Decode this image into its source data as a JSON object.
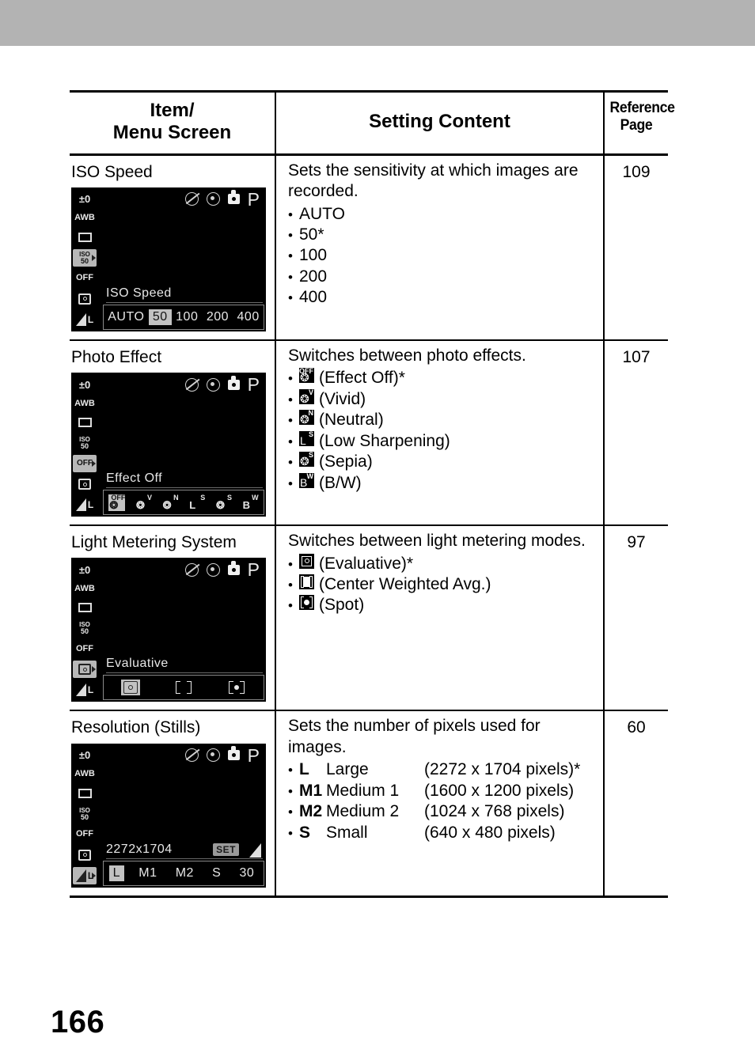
{
  "page": {
    "number": "166"
  },
  "table": {
    "headers": {
      "item": "Item/",
      "item_line2": "Menu Screen",
      "setting": "Setting Content",
      "reference": "Reference",
      "reference_line2": "Page"
    },
    "rows": [
      {
        "item": "ISO Speed",
        "ref_page": "109",
        "description": "Sets the sensitivity at which images are recorded.",
        "options": [
          {
            "text": "AUTO"
          },
          {
            "text": "50*"
          },
          {
            "text": "100"
          },
          {
            "text": "200"
          },
          {
            "text": "400"
          }
        ],
        "lcd": {
          "label": "ISO Speed",
          "bar_items": [
            {
              "text": "AUTO",
              "selected": false
            },
            {
              "text": "50",
              "selected": true
            },
            {
              "text": "100",
              "selected": false
            },
            {
              "text": "200",
              "selected": false
            },
            {
              "text": "400",
              "selected": false
            }
          ],
          "side_icons": [
            {
              "name": "exposure-compensation",
              "text": "±0",
              "selected": false
            },
            {
              "name": "white-balance",
              "text": "AWB",
              "selected": false
            },
            {
              "name": "drive-mode",
              "text": "",
              "selected": false
            },
            {
              "name": "iso-speed",
              "text": "ISO",
              "sub": "50",
              "selected": true
            },
            {
              "name": "flash-off",
              "text": "OFF",
              "selected": false
            },
            {
              "name": "metering",
              "text": "",
              "selected": false
            },
            {
              "name": "image-quality",
              "text": "L",
              "selected": false
            }
          ],
          "top_icons": [
            "flash-off-icon",
            "red-eye-icon",
            "macro-icon",
            "mode-p"
          ],
          "mode": "P"
        }
      },
      {
        "item": "Photo Effect",
        "ref_page": "107",
        "description": "Switches between photo effects.",
        "options": [
          {
            "glyph_sub": "OFF",
            "glyph_main": "❂",
            "text": "(Effect Off)*"
          },
          {
            "glyph_sub": "V",
            "glyph_main": "❂",
            "text": "(Vivid)"
          },
          {
            "glyph_sub": "N",
            "glyph_main": "❂",
            "text": "(Neutral)"
          },
          {
            "glyph_sub": "S",
            "glyph_main": "L",
            "text": "(Low Sharpening)"
          },
          {
            "glyph_sub": "S",
            "glyph_main": "❂",
            "text": "(Sepia)"
          },
          {
            "glyph_sub": "W",
            "glyph_main": "B",
            "text": "(B/W)"
          }
        ],
        "lcd": {
          "label": "Effect Off",
          "bar_items": [
            {
              "sub": "OFF",
              "main": "❂",
              "selected": true
            },
            {
              "sub": "V",
              "main": "❂",
              "selected": false
            },
            {
              "sub": "N",
              "main": "❂",
              "selected": false
            },
            {
              "sub": "S",
              "main": "L",
              "selected": false
            },
            {
              "sub": "S",
              "main": "❂",
              "selected": false
            },
            {
              "sub": "W",
              "main": "B",
              "selected": false
            }
          ],
          "side_icons": [
            {
              "name": "exposure-compensation",
              "text": "±0",
              "selected": false
            },
            {
              "name": "white-balance",
              "text": "AWB",
              "selected": false
            },
            {
              "name": "drive-mode",
              "text": "",
              "selected": false
            },
            {
              "name": "iso-speed",
              "text": "ISO",
              "sub": "50",
              "selected": false
            },
            {
              "name": "photo-effect",
              "text": "OFF",
              "selected": true
            },
            {
              "name": "metering",
              "text": "",
              "selected": false
            },
            {
              "name": "image-quality",
              "text": "L",
              "selected": false
            }
          ],
          "mode": "P"
        }
      },
      {
        "item": "Light Metering System",
        "ref_page": "97",
        "description": "Switches between light metering modes.",
        "options": [
          {
            "metering": "evaluative",
            "text": "(Evaluative)*"
          },
          {
            "metering": "center-weighted",
            "text": "(Center Weighted Avg.)"
          },
          {
            "metering": "spot",
            "text": "(Spot)"
          }
        ],
        "lcd": {
          "label": "Evaluative",
          "bar_metering": [
            {
              "type": "evaluative",
              "selected": true
            },
            {
              "type": "center-weighted",
              "selected": false
            },
            {
              "type": "spot",
              "selected": false
            }
          ],
          "side_icons": [
            {
              "name": "exposure-compensation",
              "text": "±0",
              "selected": false
            },
            {
              "name": "white-balance",
              "text": "AWB",
              "selected": false
            },
            {
              "name": "drive-mode",
              "text": "",
              "selected": false
            },
            {
              "name": "iso-speed",
              "text": "ISO",
              "sub": "50",
              "selected": false
            },
            {
              "name": "flash-off",
              "text": "OFF",
              "selected": false
            },
            {
              "name": "metering",
              "text": "",
              "selected": true
            },
            {
              "name": "image-quality",
              "text": "L",
              "selected": false
            }
          ],
          "mode": "P"
        }
      },
      {
        "item": "Resolution (Stills)",
        "ref_page": "60",
        "description": "Sets the number of pixels used for images.",
        "options": [
          {
            "code": "L",
            "name": "Large",
            "pixels": "(2272 x 1704 pixels)*"
          },
          {
            "code": "M1",
            "name": "Medium 1",
            "pixels": "(1600 x 1200 pixels)"
          },
          {
            "code": "M2",
            "name": "Medium 2",
            "pixels": "(1024 x 768 pixels)"
          },
          {
            "code": "S",
            "name": "Small",
            "pixels": "(640 x 480 pixels)"
          }
        ],
        "lcd": {
          "label": "2272x1704",
          "set_badge": "SET",
          "bar_items": [
            {
              "text": "L",
              "selected": true
            },
            {
              "text": "M1",
              "selected": false
            },
            {
              "text": "M2",
              "selected": false
            },
            {
              "text": "S",
              "selected": false
            },
            {
              "text": "30",
              "selected": false
            }
          ],
          "side_icons": [
            {
              "name": "exposure-compensation",
              "text": "±0",
              "selected": false
            },
            {
              "name": "white-balance",
              "text": "AWB",
              "selected": false
            },
            {
              "name": "drive-mode",
              "text": "",
              "selected": false
            },
            {
              "name": "iso-speed",
              "text": "ISO",
              "sub": "50",
              "selected": false
            },
            {
              "name": "flash-off",
              "text": "OFF",
              "selected": false
            },
            {
              "name": "metering",
              "text": "",
              "selected": false
            },
            {
              "name": "image-quality",
              "text": "L",
              "selected": true
            }
          ],
          "mode": "P"
        }
      }
    ]
  },
  "colors": {
    "top_band": "#b3b3b3",
    "lcd_background": "#000000",
    "lcd_text": "#e8e8e8",
    "lcd_highlight": "#c2c2c2",
    "rule": "#000000"
  }
}
